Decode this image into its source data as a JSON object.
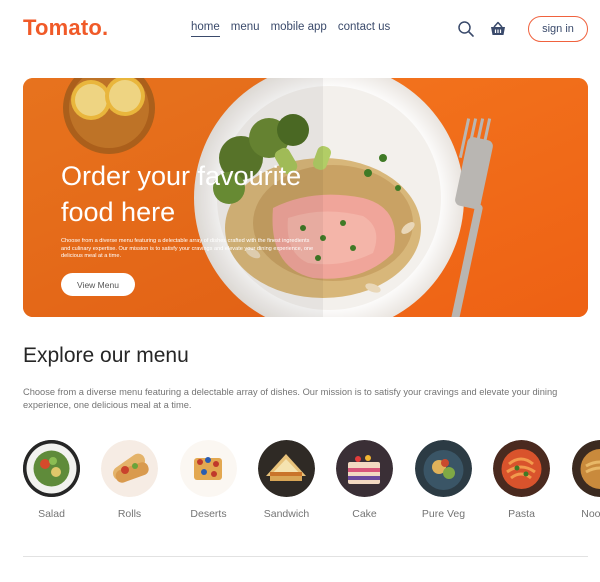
{
  "navbar": {
    "logo": "Tomato.",
    "menu": [
      {
        "label": "home",
        "active": true
      },
      {
        "label": "menu",
        "active": false
      },
      {
        "label": "mobile app",
        "active": false
      },
      {
        "label": "contact us",
        "active": false
      }
    ],
    "icons": [
      "search-icon",
      "basket-icon"
    ],
    "signin_label": "sign in"
  },
  "hero": {
    "title": "Order your favourite food here",
    "description": "Choose from a diverse menu featuring a delectable array of dishes crafted with the finest ingredients and culinary expertise. Our mission is to satisfy your cravings and elevate your dining experience, one delicious meal at a time.",
    "button_label": "View Menu"
  },
  "explore": {
    "title": "Explore our menu",
    "text": "Choose from a diverse menu featuring a delectable array of dishes. Our mission is to satisfy your cravings and elevate your dining experience, one delicious meal at a time.",
    "items": [
      {
        "label": "Salad"
      },
      {
        "label": "Rolls"
      },
      {
        "label": "Deserts"
      },
      {
        "label": "Sandwich"
      },
      {
        "label": "Cake"
      },
      {
        "label": "Pure Veg"
      },
      {
        "label": "Pasta"
      },
      {
        "label": "Noodles"
      }
    ]
  },
  "colors": {
    "brand": "#f05a28",
    "hero_background": "#f26e1e",
    "nav_text": "#3a4a6b",
    "muted_text": "#747474"
  }
}
